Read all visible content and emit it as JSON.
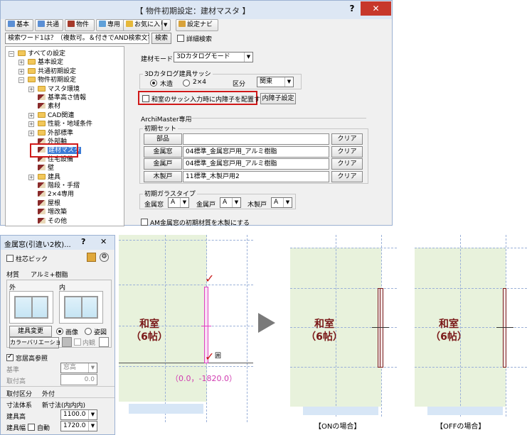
{
  "dialog": {
    "title": "【 物件初期設定：建材マスタ 】",
    "help": "?",
    "close": "✕",
    "toolbar": {
      "basic": "基本",
      "common": "共通",
      "property": "物件",
      "dedicated": "専用",
      "favorites": "お気に入り",
      "dropdown": "▼",
      "settings_navi": "設定ナビ"
    },
    "search": {
      "placeholder": "検索ワード1文字以上（複数可。＆付きでAND検索文字）",
      "value": "検索ワード1は？（複数可。＆付きでAND検索文字）",
      "button": "検索",
      "detail_label": "詳細検索"
    },
    "tree": [
      {
        "label": "すべての設定",
        "exp": "−",
        "icon": "folder-icon"
      },
      {
        "label": "基本設定",
        "exp": "+",
        "icon": "folder-icon"
      },
      {
        "label": "共通初期設定",
        "exp": "+",
        "icon": "folder-icon"
      },
      {
        "label": "物件初期設定",
        "exp": "−",
        "icon": "folder-icon"
      },
      {
        "label": "マスタ環境",
        "exp": "+",
        "icon": "folder-icon"
      },
      {
        "label": "基準高さ情報",
        "exp": "",
        "icon": "doc-icon"
      },
      {
        "label": "素材",
        "exp": "",
        "icon": "doc-icon"
      },
      {
        "label": "CAD関連",
        "exp": "+",
        "icon": "folder-icon"
      },
      {
        "label": "性能・地域条件",
        "exp": "+",
        "icon": "folder-icon"
      },
      {
        "label": "外部標準",
        "exp": "+",
        "icon": "folder-icon"
      },
      {
        "label": "外部軸",
        "exp": "",
        "icon": "doc-icon"
      },
      {
        "label": "建材マスタ",
        "exp": "",
        "icon": "doc-icon"
      },
      {
        "label": "住宅設備",
        "exp": "",
        "icon": "doc-icon"
      },
      {
        "label": "壁",
        "exp": "",
        "icon": "doc-icon"
      },
      {
        "label": "建具",
        "exp": "+",
        "icon": "folder-icon"
      },
      {
        "label": "階段・手摺",
        "exp": "",
        "icon": "doc-icon"
      },
      {
        "label": "2×4専用",
        "exp": "",
        "icon": "doc-icon"
      },
      {
        "label": "屋根",
        "exp": "",
        "icon": "doc-icon"
      },
      {
        "label": "増改築",
        "exp": "",
        "icon": "doc-icon"
      },
      {
        "label": "その他",
        "exp": "",
        "icon": "doc-icon"
      }
    ],
    "form": {
      "mode_label": "建材モード",
      "mode_value": "3Dカタログモード",
      "sash_group": "3Dカタログ建具サッシ",
      "radio_wood": "木造",
      "radio_2x4": "2×4",
      "category_label": "区分",
      "category_value": "関東",
      "washitsu_check": "和室のサッシ入力時に内障子を配置する",
      "inner_shoji_button": "内障子設定",
      "archimaster": "ArchiMaster専用",
      "initial_set": "初期セット",
      "rows": [
        {
          "button": "部品",
          "value": "",
          "clear": "クリア"
        },
        {
          "button": "金属窓",
          "value": "04標準_金属窓戸用_アルミ樹脂",
          "clear": "クリア"
        },
        {
          "button": "金属戸",
          "value": "04標準_金属窓戸用_アルミ樹脂",
          "clear": "クリア"
        },
        {
          "button": "木製戸",
          "value": "11標準_木製戸用2",
          "clear": "クリア"
        }
      ],
      "glass_group": "初期ガラスタイプ",
      "glass": [
        {
          "label": "金属窓",
          "value": "A"
        },
        {
          "label": "金属戸",
          "value": "A"
        },
        {
          "label": "木製戸",
          "value": "A"
        }
      ],
      "am_check": "AM金属窓の初期材質を木製にする"
    }
  },
  "panel": {
    "title": "金属窓(引違い2枚)...",
    "help": "?",
    "close": "✕",
    "pillar_pick": "柱芯ピック",
    "material_label": "材質",
    "material_value": "アルミ+樹脂",
    "outside": "外",
    "inside": "内",
    "change_button": "建具変更",
    "radio_image": "画像",
    "radio_shape": "姿図",
    "color_button": "カラーバリエーション",
    "inner_view": "内観",
    "sill_check": "窓居高参照",
    "base_label": "基準",
    "base_value": "窓高",
    "install_label": "取付高",
    "install_value": "0.0",
    "section_label": "取付区分",
    "section_value": "外付",
    "dim_label": "寸法体系",
    "dim_value": "新寸法(内内内)",
    "height_label": "建具高",
    "height_value": "1100.0",
    "width_label": "建具幅",
    "auto_label": "自動",
    "width_value": "1720.0"
  },
  "plans": {
    "room_label": "和室\n（6帖）",
    "coordinate": "（0.0，-1820.0）",
    "snap_mark": "囲",
    "on_caption": "【ONの場合】",
    "off_caption": "【OFFの場合】"
  }
}
